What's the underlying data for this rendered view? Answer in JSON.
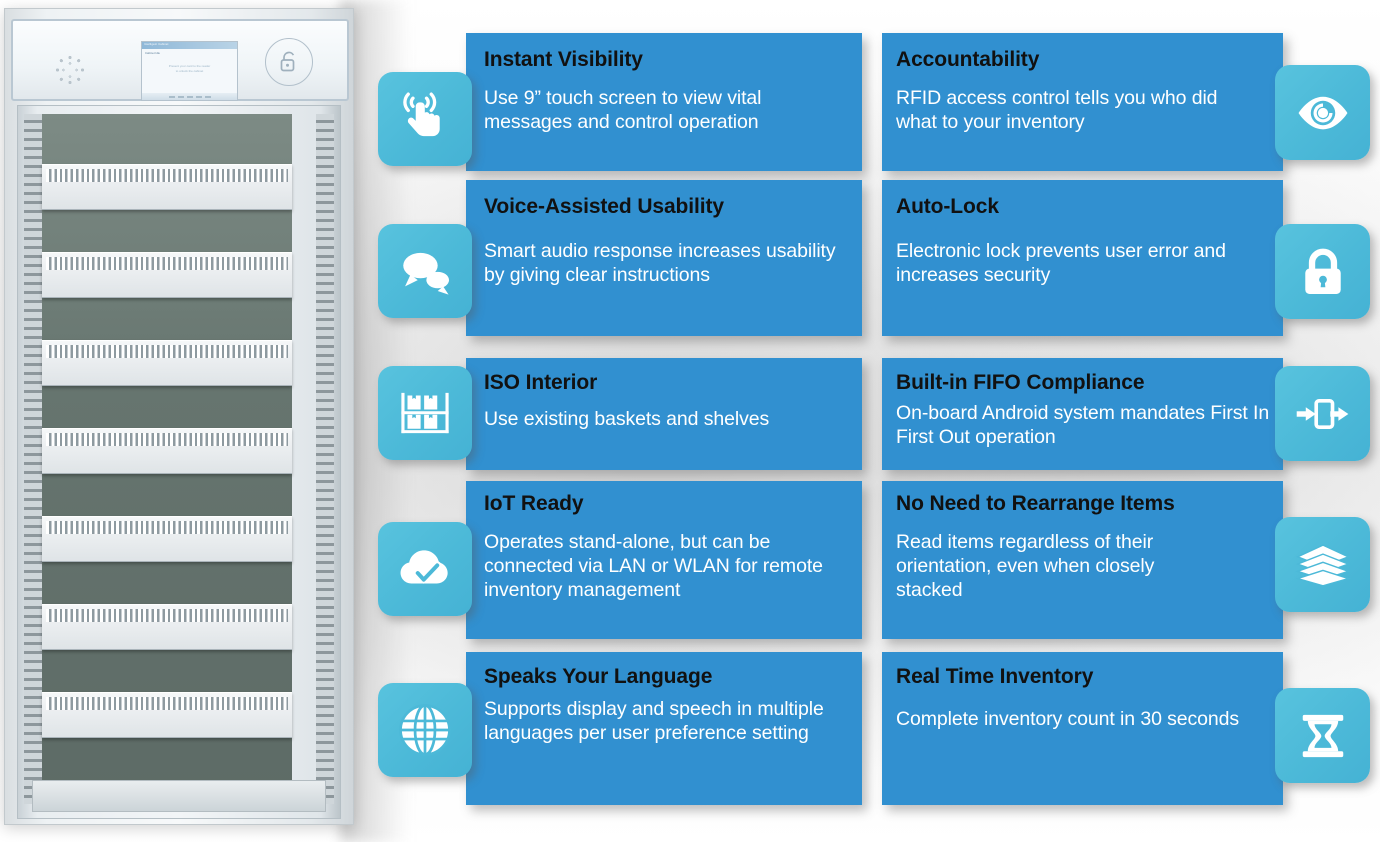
{
  "colors": {
    "card_blue": "#3190D0",
    "tile_blue": "#4CB9D8",
    "title_text": "#111111",
    "body_text": "#FFFFFF",
    "page_background": "#FFFFFF"
  },
  "product": {
    "name": "rfid-smart-cabinet",
    "alt": "RFID smart storage cabinet with touch screen, speaker and pull-out ISO baskets",
    "panel": {
      "speaker_icon": "speaker-grille-icon",
      "unlock_icon": "unlock-padlock-icon",
      "screen": {
        "status_bar_left": "Intelligent Cabinet",
        "status_bar_right": "Ready  Net  Pwr  12:40",
        "subtitle": "Cabinet Idle",
        "message_line_1": "Present your card to the reader",
        "message_line_2": "to unlock the cabinet",
        "footer_buttons": 5
      }
    },
    "shelves": 8,
    "shelf_label": "iso-basket-drawer"
  },
  "columns": {
    "left": [
      {
        "icon": "touch-screen-rfid-icon",
        "title": "Instant Visibility",
        "desc": "Use 9” touch screen to view vital messages and control operation"
      },
      {
        "icon": "speech-bubbles-icon",
        "title": "Voice-Assisted Usability",
        "desc": "Smart audio response increases usability by giving clear instructions"
      },
      {
        "icon": "shelf-with-boxes-icon",
        "title": "ISO Interior",
        "desc": "Use existing baskets and shelves"
      },
      {
        "icon": "cloud-check-icon",
        "title": "IoT Ready",
        "desc": "Operates stand-alone, but can be connected via LAN or WLAN for remote inventory management"
      },
      {
        "icon": "globe-icon",
        "title": "Speaks Your Language",
        "desc": "Supports display and speech in multiple languages per user preference setting"
      }
    ],
    "right": [
      {
        "icon": "eye-icon",
        "title": "Accountability",
        "desc": "RFID access control tells you who did what to your inventory"
      },
      {
        "icon": "padlock-closed-icon",
        "title": "Auto-Lock",
        "desc": "Electronic lock prevents user error and increases security"
      },
      {
        "icon": "fifo-arrows-icon",
        "title": "Built-in FIFO Compliance",
        "desc": "On-board Android system mandates First In First Out operation"
      },
      {
        "icon": "stacked-sheets-icon",
        "title": "No Need to Rearrange Items",
        "desc": "Read items regardless of their orientation, even when closely stacked"
      },
      {
        "icon": "hourglass-icon",
        "title": "Real Time Inventory",
        "desc": "Complete inventory count in 30 seconds"
      }
    ]
  }
}
